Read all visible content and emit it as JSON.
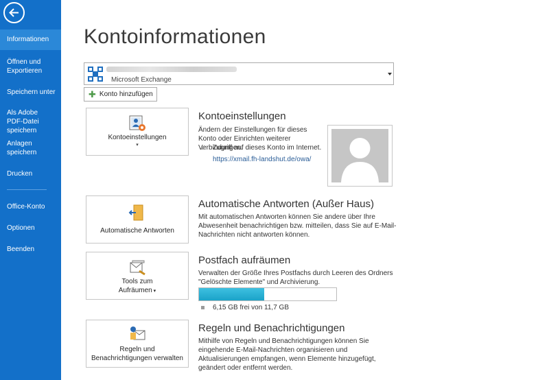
{
  "sidebar": {
    "items": [
      {
        "label": "Informationen"
      },
      {
        "label": "Öffnen und Exportieren"
      },
      {
        "label": "Speichern unter"
      },
      {
        "label": "Als Adobe PDF-Datei speichern"
      },
      {
        "label": "Anlagen speichern"
      },
      {
        "label": "Drucken"
      },
      {
        "label": "Office-Konto"
      },
      {
        "label": "Optionen"
      },
      {
        "label": "Beenden"
      }
    ]
  },
  "main": {
    "title": "Kontoinformationen",
    "account": {
      "type": "Microsoft Exchange"
    },
    "add_account_label": "Konto hinzufügen",
    "sections": [
      {
        "tile_label": "Kontoeinstellungen",
        "title": "Kontoeinstellungen",
        "desc": "Ändern der Einstellungen für dieses Konto oder Einrichten weiterer Verbindungen.",
        "bullet": "Zugriff auf dieses Konto im Internet.",
        "link": "https://xmail.fh-landshut.de/owa/"
      },
      {
        "tile_label": "Automatische Antworten",
        "title": "Automatische Antworten (Außer Haus)",
        "desc": "Mit automatischen Antworten können Sie andere über Ihre Abwesenheit benachrichtigen bzw. mitteilen, dass Sie auf E-Mail-Nachrichten nicht antworten können."
      },
      {
        "tile_label_1": "Tools zum",
        "tile_label_2": "Aufräumen",
        "title": "Postfach aufräumen",
        "desc": "Verwalten der Größe Ihres Postfachs durch Leeren des Ordners \"Gelöschte Elemente\" und Archivierung.",
        "storage_text": "6,15 GB frei von 11,7 GB",
        "used_fraction": 0.474
      },
      {
        "tile_label_1": "Regeln und",
        "tile_label_2": "Benachrichtigungen verwalten",
        "title": "Regeln und Benachrichtigungen",
        "desc": "Mithilfe von Regeln und Benachrichtigungen können Sie eingehende E-Mail-Nachrichten organisieren und Aktualisierungen empfangen, wenn Elemente hinzugefügt, geändert oder entfernt werden."
      }
    ]
  },
  "colors": {
    "sidebar": "#1370c9",
    "sidebar_active": "#2b88d8",
    "progress": "#2ab0d6",
    "link": "#2a5d97"
  },
  "icons": {
    "back": "back-arrow-icon",
    "account": "exchange-logo-icon",
    "settings": "account-settings-icon",
    "auto_reply": "auto-reply-icon",
    "cleanup": "cleanup-tools-icon",
    "rules": "rules-icon",
    "avatar": "user-avatar-icon"
  }
}
